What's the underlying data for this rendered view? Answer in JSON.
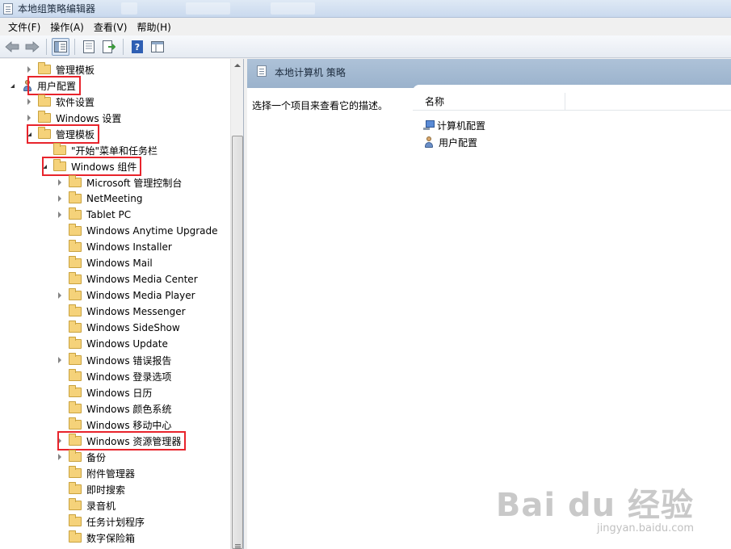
{
  "window": {
    "title": "本地组策略编辑器"
  },
  "menu": [
    {
      "label": "文件(F)"
    },
    {
      "label": "操作(A)"
    },
    {
      "label": "查看(V)"
    },
    {
      "label": "帮助(H)"
    }
  ],
  "toolbar": {
    "back_icon": "arrow-left-icon",
    "forward_icon": "arrow-right-icon",
    "show_tree_icon": "console-tree-icon",
    "properties_icon": "properties-icon",
    "export_icon": "export-list-icon",
    "help_icon": "help-icon",
    "extended_icon": "extended-view-icon"
  },
  "tree": [
    {
      "label": "管理模板",
      "depth": 1,
      "expander": "closed",
      "icon": "folder",
      "highlight": false
    },
    {
      "label": "用户配置",
      "depth": 0,
      "expander": "open",
      "icon": "user",
      "highlight": true
    },
    {
      "label": "软件设置",
      "depth": 1,
      "expander": "closed",
      "icon": "folder",
      "highlight": false
    },
    {
      "label": "Windows 设置",
      "depth": 1,
      "expander": "closed",
      "icon": "folder",
      "highlight": false
    },
    {
      "label": "管理模板",
      "depth": 1,
      "expander": "open",
      "icon": "folder",
      "highlight": true
    },
    {
      "label": "\"开始\"菜单和任务栏",
      "depth": 2,
      "expander": "none",
      "icon": "folder",
      "highlight": false
    },
    {
      "label": "Windows 组件",
      "depth": 2,
      "expander": "open",
      "icon": "folder",
      "highlight": true
    },
    {
      "label": "Microsoft 管理控制台",
      "depth": 3,
      "expander": "closed",
      "icon": "folder",
      "highlight": false
    },
    {
      "label": "NetMeeting",
      "depth": 3,
      "expander": "closed",
      "icon": "folder",
      "highlight": false
    },
    {
      "label": "Tablet PC",
      "depth": 3,
      "expander": "closed",
      "icon": "folder",
      "highlight": false
    },
    {
      "label": "Windows Anytime Upgrade",
      "depth": 3,
      "expander": "none",
      "icon": "folder",
      "highlight": false
    },
    {
      "label": "Windows Installer",
      "depth": 3,
      "expander": "none",
      "icon": "folder",
      "highlight": false
    },
    {
      "label": "Windows Mail",
      "depth": 3,
      "expander": "none",
      "icon": "folder",
      "highlight": false
    },
    {
      "label": "Windows Media Center",
      "depth": 3,
      "expander": "none",
      "icon": "folder",
      "highlight": false
    },
    {
      "label": "Windows Media Player",
      "depth": 3,
      "expander": "closed",
      "icon": "folder",
      "highlight": false
    },
    {
      "label": "Windows Messenger",
      "depth": 3,
      "expander": "none",
      "icon": "folder",
      "highlight": false
    },
    {
      "label": "Windows SideShow",
      "depth": 3,
      "expander": "none",
      "icon": "folder",
      "highlight": false
    },
    {
      "label": "Windows Update",
      "depth": 3,
      "expander": "none",
      "icon": "folder",
      "highlight": false
    },
    {
      "label": "Windows 错误报告",
      "depth": 3,
      "expander": "closed",
      "icon": "folder",
      "highlight": false
    },
    {
      "label": "Windows 登录选项",
      "depth": 3,
      "expander": "none",
      "icon": "folder",
      "highlight": false
    },
    {
      "label": "Windows 日历",
      "depth": 3,
      "expander": "none",
      "icon": "folder",
      "highlight": false
    },
    {
      "label": "Windows 颜色系统",
      "depth": 3,
      "expander": "none",
      "icon": "folder",
      "highlight": false
    },
    {
      "label": "Windows 移动中心",
      "depth": 3,
      "expander": "none",
      "icon": "folder",
      "highlight": false
    },
    {
      "label": "Windows 资源管理器",
      "depth": 3,
      "expander": "closed",
      "icon": "folder",
      "highlight": true
    },
    {
      "label": "备份",
      "depth": 3,
      "expander": "closed",
      "icon": "folder",
      "highlight": false
    },
    {
      "label": "附件管理器",
      "depth": 3,
      "expander": "none",
      "icon": "folder",
      "highlight": false
    },
    {
      "label": "即时搜索",
      "depth": 3,
      "expander": "none",
      "icon": "folder",
      "highlight": false
    },
    {
      "label": "录音机",
      "depth": 3,
      "expander": "none",
      "icon": "folder",
      "highlight": false
    },
    {
      "label": "任务计划程序",
      "depth": 3,
      "expander": "none",
      "icon": "folder",
      "highlight": false
    },
    {
      "label": "数字保险箱",
      "depth": 3,
      "expander": "none",
      "icon": "folder",
      "highlight": false
    }
  ],
  "right": {
    "header_title": "本地计算机 策略",
    "description": "选择一个项目来查看它的描述。",
    "column_name": "名称",
    "items": [
      {
        "label": "计算机配置",
        "icon": "computer"
      },
      {
        "label": "用户配置",
        "icon": "user"
      }
    ]
  },
  "watermark": {
    "main": "Bai du 经验",
    "sub": "jingyan.baidu.com"
  },
  "colors": {
    "highlight_box": "#e8242c",
    "header_bg": "#a4bad2"
  }
}
